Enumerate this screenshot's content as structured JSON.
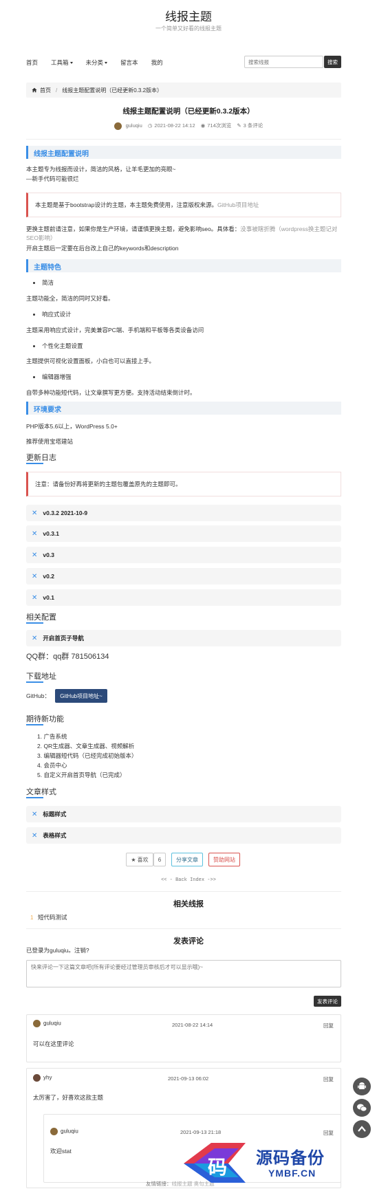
{
  "site": {
    "title": "线报主题",
    "subtitle": "一个简单又好看的线报主题"
  },
  "nav": {
    "items": [
      "首页",
      "工具箱",
      "未分类",
      "留言本",
      "我的"
    ],
    "search_placeholder": "搜索线报",
    "search_button": "搜索"
  },
  "breadcrumb": {
    "home": "首页",
    "sep": "/",
    "current": "线报主题配置说明（已经更新0.3.2版本）"
  },
  "post": {
    "title": "线报主题配置说明（已经更新0.3.2版本）",
    "author": "guluqiu",
    "date": "2021-08-22 14:12",
    "views": "714次浏览",
    "comments": "3 条评论"
  },
  "content": {
    "h_config": "线报主题配置说明",
    "intro1": "本主题专为线报而设计，简洁的风格，让羊毛更加的亮眼~",
    "intro2": "—新手代码可能很烂",
    "notice1_text": "本主题是基于bootstrap设计的主题，本主题免费使用，注意版权来源。",
    "notice1_link": "GitHub项目地址",
    "update_prefix": "更换主题前请注意，如果你是生产环境，请谨慎更换主题，避免影响seo。具体看：",
    "update_link": "没事被瞎折腾（wordpress换主题记对SEO影响）",
    "update_after": "开启主题后一定要在后台改上自己的keywords和description",
    "h_features": "主题特色",
    "f1": "简洁",
    "f1d": "主题功能全，简洁的同时又好看。",
    "f2": "响应式设计",
    "f2d": "主题采用响应式设计，完美兼容PC端、手机端和平板等各类设备访问",
    "f3": "个性化主题设置",
    "f3d": "主题提供可视化设置面板，小白也可以直接上手。",
    "f4": "编辑器增强",
    "f4d": "自带多种功能短代码，让文章撰写更方便。支持活动结束倒计时。",
    "h_env": "环境要求",
    "env1": "PHP版本5.6以上，WordPress 5.0+",
    "env2": "推荐使用宝塔建站",
    "h_changelog": "更新日志",
    "notice2": "注意：请备份好再将更新的主题包覆盖原先的主题即可。",
    "versions": [
      "v0.3.2 2021-10-9",
      "v0.3.1",
      "v0.3",
      "v0.2",
      "v0.1"
    ],
    "h_related_cfg": "相关配置",
    "cfg_item": "开启首页子导航",
    "qq": "QQ群：qq群 781506134",
    "h_download": "下载地址",
    "github_label": "GitHub：",
    "github_button": "GitHub项目地址~",
    "h_expect": "期待新功能",
    "expect": [
      "1. 广告系统",
      "2. QR生成器、文章生成器、视频解析",
      "3. 编辑器短代码（已经完成初始版本）",
      "4. 会员中心",
      "5. 自定义开启首页导航（已完成）"
    ],
    "h_style": "文章样式",
    "styles": [
      "标题样式",
      "表格样式"
    ]
  },
  "actions": {
    "like": "喜欢",
    "like_count": "6",
    "share": "分享文章",
    "donate": "赞助网站",
    "back": "<< - Back Index ->>"
  },
  "related": {
    "title": "相关线报",
    "item_num": "1",
    "item": "短代码测试"
  },
  "comment_form": {
    "title": "发表评论",
    "logged": "已登录为guluqiu。注销?",
    "placeholder": "快来评论一下这篇文章吧(所有评论要经过管理员审核后才可以显示哦)~",
    "submit": "发表评论"
  },
  "comments": [
    {
      "author": "guluqiu",
      "date": "2021-08-22 14:14",
      "reply": "回复",
      "text": "可以在这里评论"
    },
    {
      "author": "yhy",
      "date": "2021-09-13 06:02",
      "reply": "回复",
      "text": "太厉害了，好喜欢这款主题"
    },
    {
      "author": "guluqiu",
      "date": "2021-09-13 21:18",
      "reply": "回复",
      "text": "欢迎stat"
    }
  ],
  "footer": {
    "links": "友情链接：",
    "links_items": "线报主题 奥句主题"
  },
  "watermark": {
    "cn": "源码备份",
    "en": "YMBF.CN",
    "glyph": "码"
  }
}
